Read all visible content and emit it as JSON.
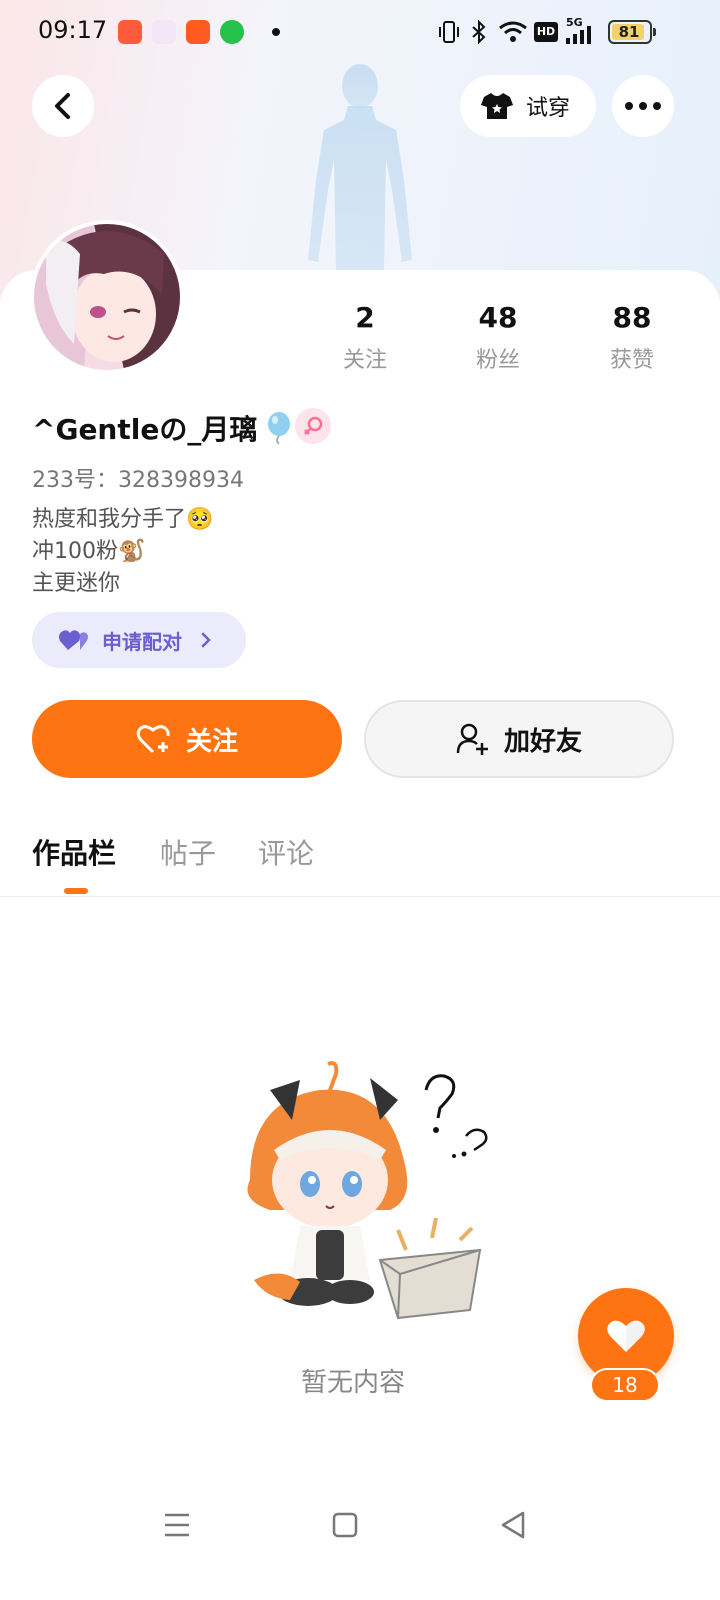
{
  "status_bar": {
    "time": "09:17",
    "battery": "81",
    "network": "5G",
    "hd": "HD",
    "icons": [
      "app-1-icon",
      "app-2-icon",
      "app-3-icon",
      "wechat-icon",
      "vibrate-icon",
      "bluetooth-icon",
      "wifi-icon",
      "signal-icon"
    ]
  },
  "header": {
    "try_on_label": "试穿"
  },
  "stats": [
    {
      "value": "2",
      "label": "关注"
    },
    {
      "value": "48",
      "label": "粉丝"
    },
    {
      "value": "88",
      "label": "获赞"
    }
  ],
  "profile": {
    "name": "^Gentleの_月璃",
    "uid": "233号：328398934",
    "bio": [
      "热度和我分手了🥺",
      "冲100粉🐒",
      "主更迷你"
    ],
    "pair_label": "申请配对"
  },
  "actions": {
    "follow_label": "关注",
    "add_friend_label": "加好友"
  },
  "tabs": [
    {
      "label": "作品栏",
      "active": true
    },
    {
      "label": "帖子",
      "active": false
    },
    {
      "label": "评论",
      "active": false
    }
  ],
  "empty": {
    "text": "暂无内容"
  },
  "like_fab": {
    "count": "18"
  },
  "colors": {
    "accent": "#ff7412",
    "pair_bg": "#ecebfb",
    "pair_text": "#6a5fd0"
  }
}
